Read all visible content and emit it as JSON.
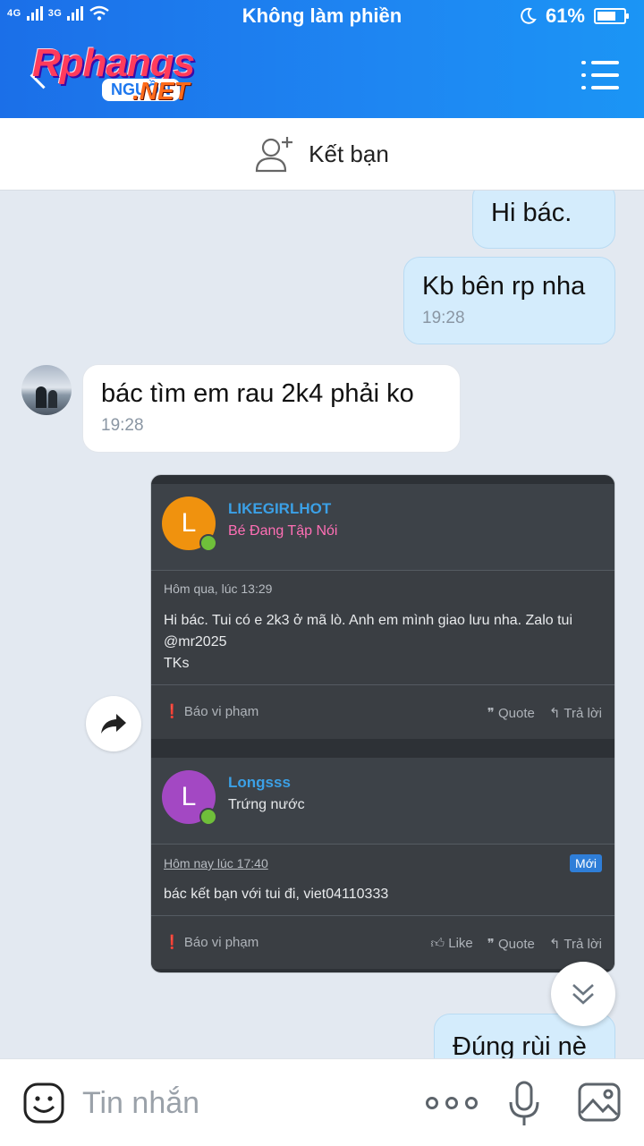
{
  "status": {
    "left": "4G 3G",
    "title": "Không làm phiền",
    "battery": "61%"
  },
  "header": {
    "logo_main": "Rphangs",
    "logo_sub": "NGUỒN",
    "logo_net": ".NET"
  },
  "add_friend": {
    "label": "Kết bạn"
  },
  "messages": [
    {
      "dir": "out",
      "text": "Hi bác."
    },
    {
      "dir": "out",
      "text": "Kb bên rp nha",
      "time": "19:28"
    },
    {
      "dir": "in",
      "text": "bác tìm em rau 2k4 phải ko",
      "time": "19:28"
    },
    {
      "dir": "out",
      "text": "Đúng rùi nè"
    }
  ],
  "shared_image": {
    "post1": {
      "avatar_letter": "L",
      "name": "LIKEGIRLHOT",
      "role": "Bé Đang Tập Nói",
      "date": "Hôm qua, lúc 13:29",
      "body_line1": "Hi bác. Tui có e 2k3 ở mã lò. Anh em mình giao lưu nha. Zalo tui",
      "body_line2": "@mr2025",
      "body_line3": "TKs",
      "report": "Báo vi phạm",
      "quote": "Quote",
      "reply": "Trả lời"
    },
    "post2": {
      "avatar_letter": "L",
      "name": "Longsss",
      "role": "Trứng nước",
      "date": "Hôm nay lúc 17:40",
      "badge": "Mới",
      "body": "bác kết bạn với tui đi, viet04110333",
      "report": "Báo vi phạm",
      "like": "Like",
      "quote": "Quote",
      "reply": "Trả lời"
    }
  },
  "input": {
    "placeholder": "Tin nhắn"
  },
  "colors": {
    "header_blue": "#1b7eec",
    "out_bubble": "#d4ecfc",
    "link_blue": "#3ba0e6"
  }
}
